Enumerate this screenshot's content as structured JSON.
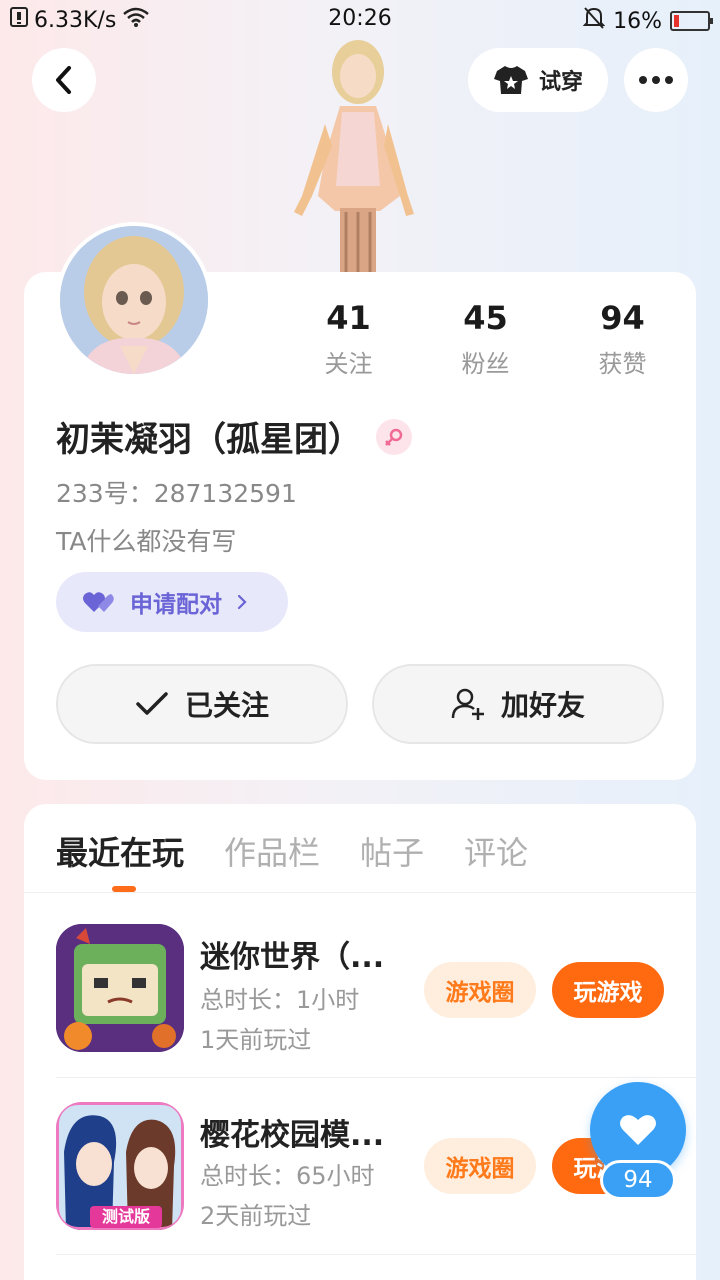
{
  "status_bar": {
    "net_speed": "6.33K/s",
    "time": "20:26",
    "battery": "16%",
    "battery_level": 0.16
  },
  "header": {
    "try_on_label": "试穿"
  },
  "profile": {
    "stats": [
      {
        "value": "41",
        "label": "关注"
      },
      {
        "value": "45",
        "label": "粉丝"
      },
      {
        "value": "94",
        "label": "获赞"
      }
    ],
    "nickname": "初茉凝羽（孤星团）",
    "uid": "233号：287132591",
    "bio": "TA什么都没有写",
    "match_label": "申请配对",
    "follow_label": "已关注",
    "add_friend_label": "加好友"
  },
  "tabs": [
    "最近在玩",
    "作品栏",
    "帖子",
    "评论"
  ],
  "games": [
    {
      "name": "迷你世界（...",
      "total_time": "总时长：1小时",
      "last_played": "1天前玩过",
      "circle_label": "游戏圈",
      "play_label": "玩游戏"
    },
    {
      "name": "樱花校园模...",
      "total_time": "总时长：65小时",
      "last_played": "2天前玩过",
      "circle_label": "游戏圈",
      "play_label": "玩游戏",
      "badge": "测试版"
    }
  ],
  "like_fab": {
    "count": "94"
  },
  "colors": {
    "accent_orange": "#ff6a10",
    "like_blue": "#3aa0f5",
    "match_purple": "#6a64d6"
  }
}
